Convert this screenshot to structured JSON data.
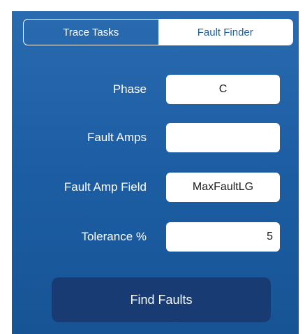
{
  "tabs": {
    "trace_tasks": "Trace Tasks",
    "fault_finder": "Fault Finder",
    "selected": "Fault Finder"
  },
  "form": {
    "phase": {
      "label": "Phase",
      "value": "C"
    },
    "fault_amps": {
      "label": "Fault Amps",
      "value": ""
    },
    "fault_amp_field": {
      "label": "Fault Amp Field",
      "value": "MaxFaultLG"
    },
    "tolerance": {
      "label": "Tolerance %",
      "value": "5"
    }
  },
  "actions": {
    "find_faults": "Find Faults"
  },
  "colors": {
    "panel_top": "#2a6bb0",
    "panel_bottom": "#175495",
    "button": "#173b72",
    "selected_tab_text": "#1f5e9e"
  }
}
